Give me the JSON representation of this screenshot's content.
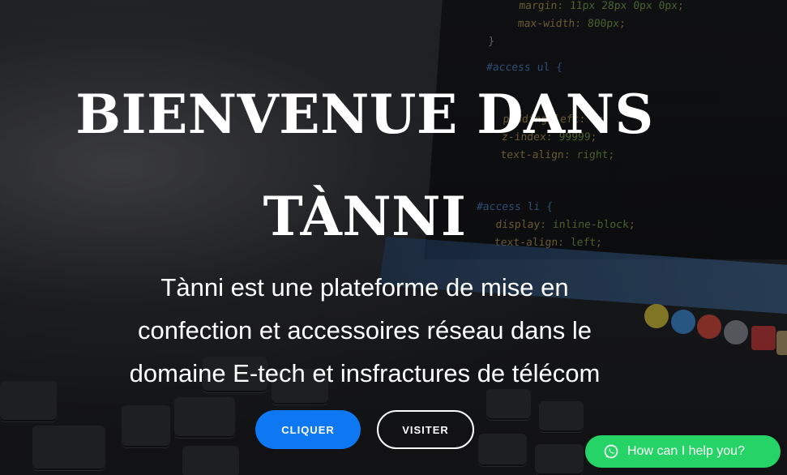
{
  "hero": {
    "title_line1": "BIENVENUE DANS",
    "title_line2": "TÀNNI",
    "subtitle_line1": "Tànni est une plateforme de mise en",
    "subtitle_line2": "confection et accessoires réseau dans le",
    "subtitle_line3": "domaine E-tech et insfractures de télécom",
    "primary_button": "CLIQUER",
    "secondary_button": "VISITER"
  },
  "chat_widget": {
    "label": "How can I help you?",
    "icon": "whatsapp-icon",
    "color": "#25d366"
  },
  "colors": {
    "primary_button": "#0d78f2",
    "text": "#ffffff"
  }
}
